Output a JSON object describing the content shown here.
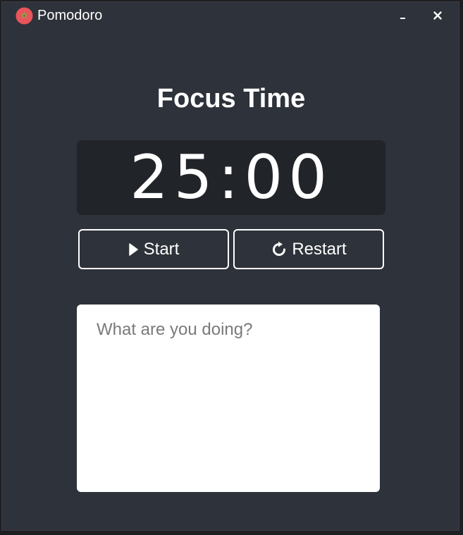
{
  "window": {
    "title": "Pomodoro",
    "icon": "tomato-icon",
    "controls": {
      "minimize": "minimize-icon",
      "close": "close-icon"
    }
  },
  "main": {
    "heading": "Focus Time",
    "timer": "25:00",
    "start_label": "Start",
    "restart_label": "Restart",
    "notes_placeholder": "What are you doing?",
    "notes_value": ""
  },
  "colors": {
    "background": "#2e323a",
    "timer_background": "#212429",
    "text": "#ffffff",
    "accent": "#e8555a"
  }
}
